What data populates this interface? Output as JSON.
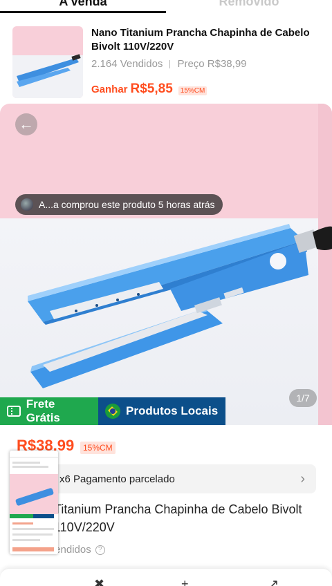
{
  "tabs": [
    {
      "label": "A venda"
    },
    {
      "label": "Removido"
    }
  ],
  "product": {
    "title": "Nano Titanium Prancha Chapinha de Cabelo Bivolt 110V/220V",
    "sold": "2.164 Vendidos",
    "price_label": "Preço R$38,99",
    "earn_label": "Ganhar",
    "earn_amount": "R$5,85",
    "commission_badge": "15%CM"
  },
  "gallery": {
    "recent_purchase": "A...a comprou este produto 5 horas atrás",
    "counter": "1/7",
    "back_icon": "arrow-left-icon"
  },
  "badges": {
    "free_shipping": "Frete Grátis",
    "local_products": "Produtos Locais",
    "colors": {
      "green": "#1fa84e",
      "navy": "#0c4f8a",
      "accent": "#ff4d1f"
    }
  },
  "details": {
    "price": "R$38,99",
    "commission_badge": "15%CM",
    "installments": "x6 Pagamento parcelado",
    "title": "Titanium Prancha Chapinha de Cabelo Bivolt 110V/220V",
    "sold": "Vendidos"
  }
}
